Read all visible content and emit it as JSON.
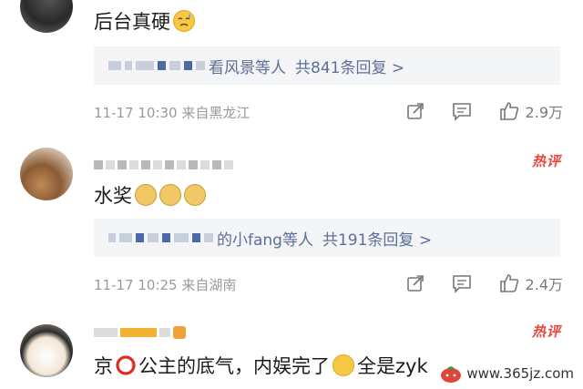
{
  "comments": [
    {
      "content": "后台真硬",
      "emoji": "cold-sweat-emoji",
      "reply_suffix": "看风景等人",
      "reply_count": "共841条回复 >",
      "meta": "11-17 10:30 来自黑龙江",
      "likes": "2.9万"
    },
    {
      "hot_badge": "热评",
      "content": "水奖",
      "emoji": "doge-emoji",
      "reply_suffix": "的小fang等人",
      "reply_count": "共191条回复 >",
      "meta": "11-17 10:25 来自湖南",
      "likes": "2.4万"
    },
    {
      "hot_badge": "热评",
      "content_a": "京",
      "content_b": "公主的底气，内娱完了",
      "content_c": "全是zyk",
      "emojis": [
        "red-circle-icon",
        "crying-laughing-emoji"
      ]
    }
  ],
  "watermark": "www.365jz.com",
  "colors": {
    "link": "#5c6f99",
    "hot": "#e8473c",
    "meta": "#9a9a9a",
    "reply_bg": "#f4f5f6"
  }
}
